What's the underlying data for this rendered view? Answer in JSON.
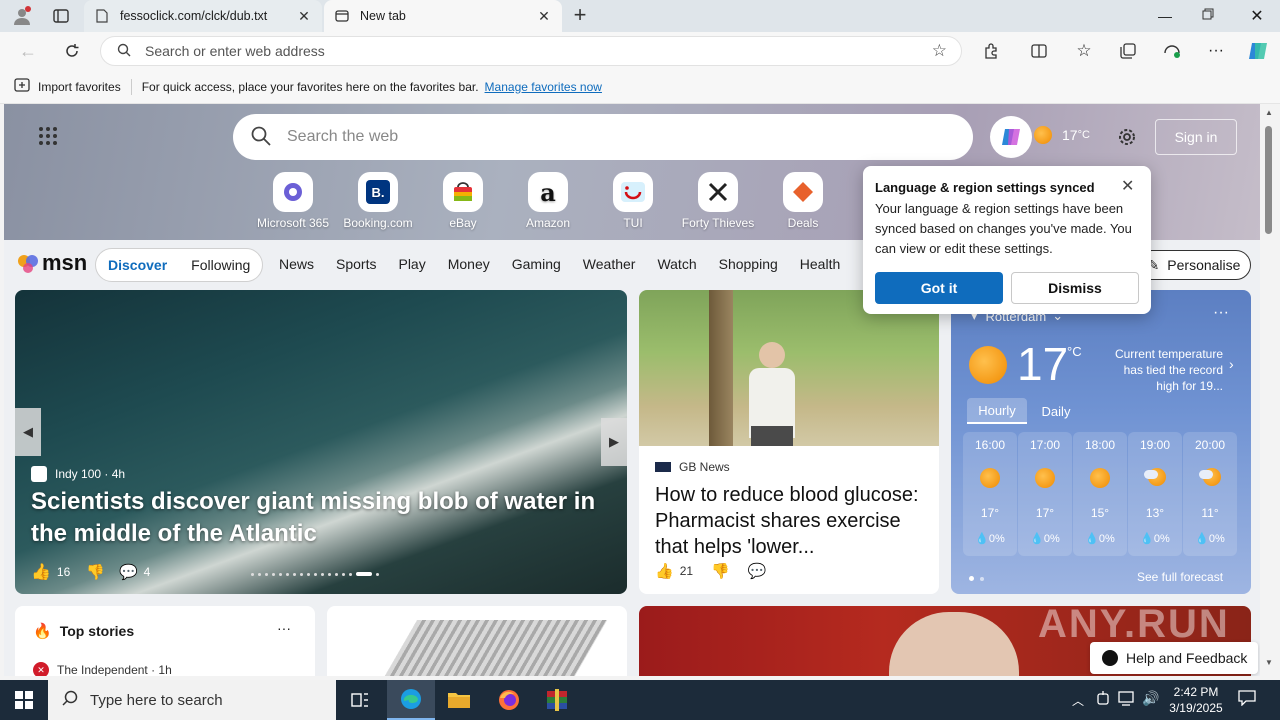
{
  "browser": {
    "tabs": [
      {
        "title": "fessoclick.com/clck/dub.txt",
        "icon": "document-icon"
      },
      {
        "title": "New tab",
        "icon": "newtab-icon"
      }
    ],
    "address_placeholder": "Search or enter web address",
    "favorites_bar": {
      "import_label": "Import favorites",
      "message": "For quick access, place your favorites here on the favorites bar.",
      "manage_link": "Manage favorites now"
    }
  },
  "msn": {
    "search_placeholder": "Search the web",
    "weather_temp": "17",
    "weather_unit": "°C",
    "sign_in": "Sign in",
    "quick_links": [
      {
        "label": "Microsoft 365",
        "color": "#6b5fd6"
      },
      {
        "label": "Booking.com",
        "color": "#003580"
      },
      {
        "label": "eBay",
        "color": "#e53238"
      },
      {
        "label": "Amazon",
        "color": "#111111"
      },
      {
        "label": "TUI",
        "color": "#70cbf4"
      },
      {
        "label": "Forty Thieves",
        "color": "#222222"
      },
      {
        "label": "Deals",
        "color": "#e8612c"
      }
    ],
    "logo": "msn",
    "nav": {
      "discover": "Discover",
      "following": "Following",
      "links": [
        "News",
        "Sports",
        "Play",
        "Money",
        "Gaming",
        "Weather",
        "Watch",
        "Shopping",
        "Health"
      ],
      "personalise": "Personalise"
    },
    "hero": {
      "source": "Indy 100 · 4h",
      "headline": "Scientists discover giant missing blob of water in the middle of the Atlantic",
      "likes": "16",
      "comments": "4"
    },
    "gb_card": {
      "source": "GB News",
      "headline": "How to reduce blood glucose: Pharmacist shares exercise that helps 'lower...",
      "likes": "21"
    },
    "weather_card": {
      "location": "Rotterdam",
      "temp": "17",
      "unit": "°C",
      "note": "Current temperature has tied the record high for 19...",
      "tab_hourly": "Hourly",
      "tab_daily": "Daily",
      "hours": [
        {
          "time": "16:00",
          "temp": "17°",
          "precip": "0%",
          "icon": "sunny-icon"
        },
        {
          "time": "17:00",
          "temp": "17°",
          "precip": "0%",
          "icon": "sunny-icon"
        },
        {
          "time": "18:00",
          "temp": "15°",
          "precip": "0%",
          "icon": "sunny-icon"
        },
        {
          "time": "19:00",
          "temp": "13°",
          "precip": "0%",
          "icon": "partly-cloudy-icon"
        },
        {
          "time": "20:00",
          "temp": "11°",
          "precip": "0%",
          "icon": "partly-cloudy-icon"
        }
      ],
      "full_forecast": "See full forecast"
    },
    "top_stories": {
      "title": "Top stories",
      "first_source": "The Independent · 1h"
    },
    "popup": {
      "title": "Language & region settings synced",
      "body": "Your language & region settings have been synced based on changes you've made. You can view or edit these settings.",
      "got_it": "Got it",
      "dismiss": "Dismiss"
    },
    "help_feedback": "Help and Feedback",
    "watermark": "ANY.RUN"
  },
  "taskbar": {
    "search_placeholder": "Type here to search",
    "time": "2:42 PM",
    "date": "3/19/2025"
  },
  "colors": {
    "accent": "#0f6cbd",
    "taskbar": "#1c2b3a"
  }
}
